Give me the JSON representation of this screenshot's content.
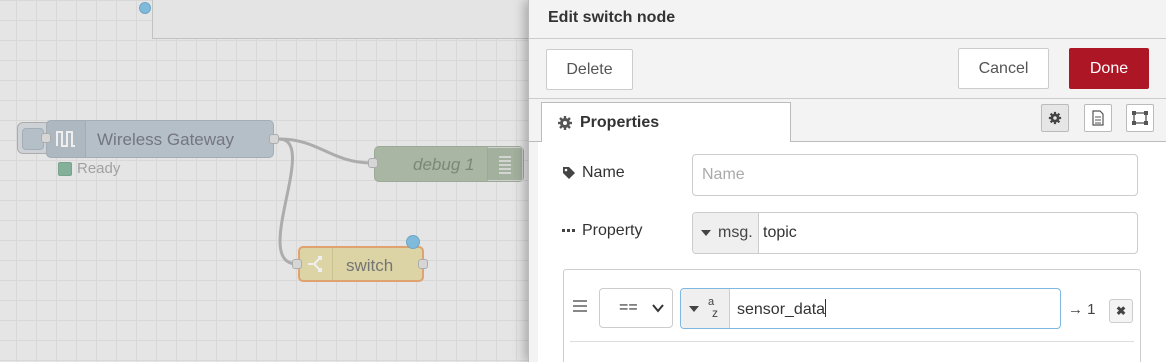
{
  "workspace": {
    "nodes": {
      "gateway": {
        "label": "Wireless Gateway",
        "status": "Ready",
        "status_color": "#5a9e7a",
        "icon": "wave-icon"
      },
      "debug": {
        "label": "debug 1",
        "icon": "list-icon"
      },
      "switch": {
        "label": "switch",
        "icon": "switch-icon"
      }
    },
    "colors": {
      "gateway": "#a5b6c4",
      "debug": "#93a88a",
      "switch": "#e2d68e",
      "selection": "#e8893a"
    }
  },
  "tray": {
    "title": "Edit switch node",
    "toolbar": {
      "delete_label": "Delete",
      "cancel_label": "Cancel",
      "done_label": "Done"
    },
    "tabs": {
      "properties_label": "Properties"
    },
    "form": {
      "name_label": "Name",
      "name_placeholder": "Name",
      "property_label": "Property",
      "property_type": "msg.",
      "property_value": "topic",
      "rule": {
        "operator": "==",
        "value_type_icon": "az-string-icon",
        "value_type_a": "a",
        "value_type_z": "z",
        "value": "sensor_data",
        "output": "→ 1",
        "remove": "✖"
      }
    },
    "colors": {
      "done": "#ad1625"
    }
  }
}
